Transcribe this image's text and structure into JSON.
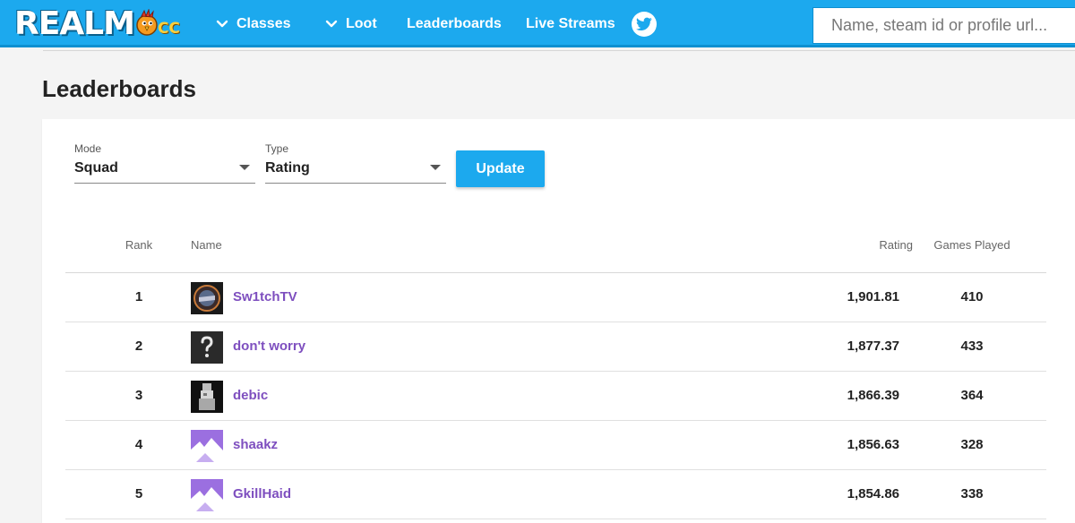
{
  "brand": {
    "logo_main": "REALM",
    "logo_suffix": "CC"
  },
  "nav": {
    "classes": "Classes",
    "loot": "Loot",
    "leaderboards": "Leaderboards",
    "live_streams": "Live Streams"
  },
  "search": {
    "placeholder": "Name, steam id or profile url..."
  },
  "page": {
    "title": "Leaderboards"
  },
  "filters": {
    "mode": {
      "label": "Mode",
      "value": "Squad"
    },
    "type": {
      "label": "Type",
      "value": "Rating"
    },
    "update_label": "Update"
  },
  "table": {
    "headers": {
      "rank": "Rank",
      "name": "Name",
      "rating": "Rating",
      "games": "Games Played"
    },
    "rows": [
      {
        "rank": "1",
        "name": "Sw1tchTV",
        "rating": "1,901.81",
        "games": "410",
        "avatar": "switchtv-avatar"
      },
      {
        "rank": "2",
        "name": "don't worry",
        "rating": "1,877.37",
        "games": "433",
        "avatar": "question-mark-avatar"
      },
      {
        "rank": "3",
        "name": "debic",
        "rating": "1,866.39",
        "games": "364",
        "avatar": "debic-avatar"
      },
      {
        "rank": "4",
        "name": "shaakz",
        "rating": "1,856.63",
        "games": "328",
        "avatar": "default-purple-avatar"
      },
      {
        "rank": "5",
        "name": "GkillHaid",
        "rating": "1,854.86",
        "games": "338",
        "avatar": "default-purple-avatar"
      }
    ]
  },
  "colors": {
    "topbar": "#1ca9ee",
    "accent_button": "#1ca9ee",
    "player_name": "#7e4fbf",
    "avatar_purple": "#9b6fe0"
  },
  "icons": {
    "nav_chevron": "chevron-down-icon",
    "social": "twitter-icon",
    "dropdown": "caret-down-icon"
  }
}
